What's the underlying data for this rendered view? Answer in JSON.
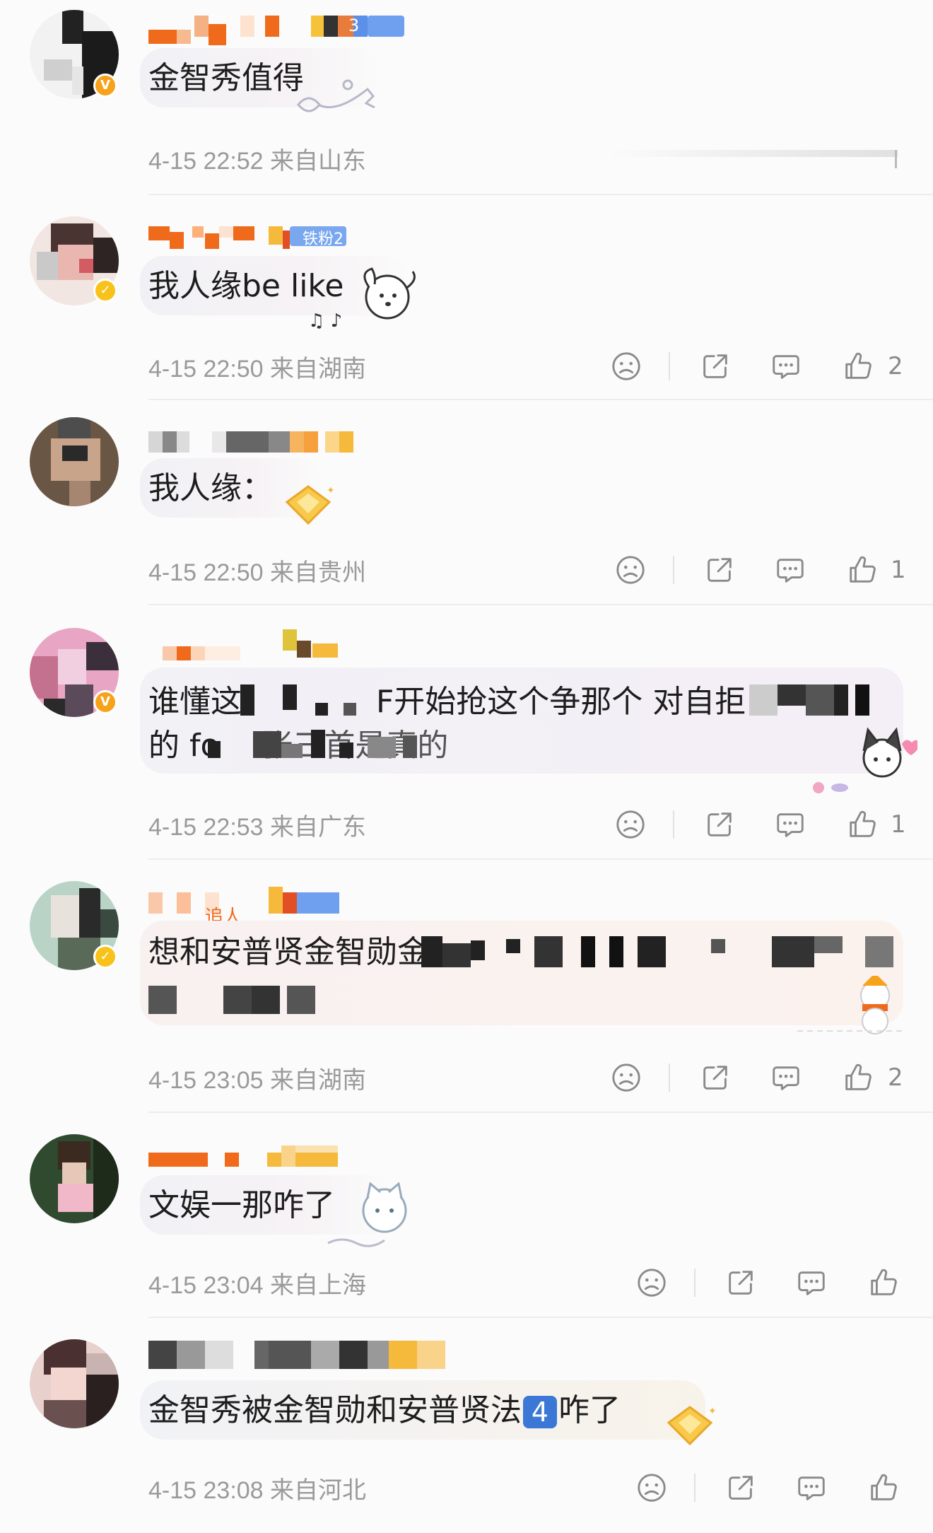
{
  "comments": [
    {
      "text": "金智秀值得",
      "location": "4-15 22:52 来自山东",
      "likes": "",
      "level_badge": "3"
    },
    {
      "text": "我人缘be like",
      "location": "4-15 22:50 来自湖南",
      "likes": "2",
      "level_badge": "铁粉2"
    },
    {
      "text": "我人缘：",
      "location": "4-15 22:50 来自贵州",
      "likes": "1"
    },
    {
      "text_line1": "谁懂这",
      "text_mid1": "F开始抢这个争那个 对自拒",
      "text_line2": "的 fo",
      "text_mid2": "张三首是真的",
      "location": "4-15 22:53 来自广东",
      "likes": "1"
    },
    {
      "text": "想和安普贤金智勋金",
      "location": "4-15 23:05 来自湖南",
      "likes": "2",
      "name_partial": "追人"
    },
    {
      "text": "文娱一那咋了",
      "location": "4-15 23:04 来自上海",
      "likes": ""
    },
    {
      "text_a": "金智秀被金智勋和安普贤法",
      "badge": "4",
      "text_b": "咋了",
      "location": "4-15 23:08 来自河北",
      "likes": ""
    }
  ],
  "icons": {
    "dislike": "sad-face-icon",
    "share": "share-icon",
    "reply": "comment-bubble-icon",
    "like": "thumbs-up-icon"
  },
  "colors": {
    "name_orange": "#f06a1c",
    "verified_orange": "#f7a21b",
    "meta_gray": "#9a9a9a"
  }
}
